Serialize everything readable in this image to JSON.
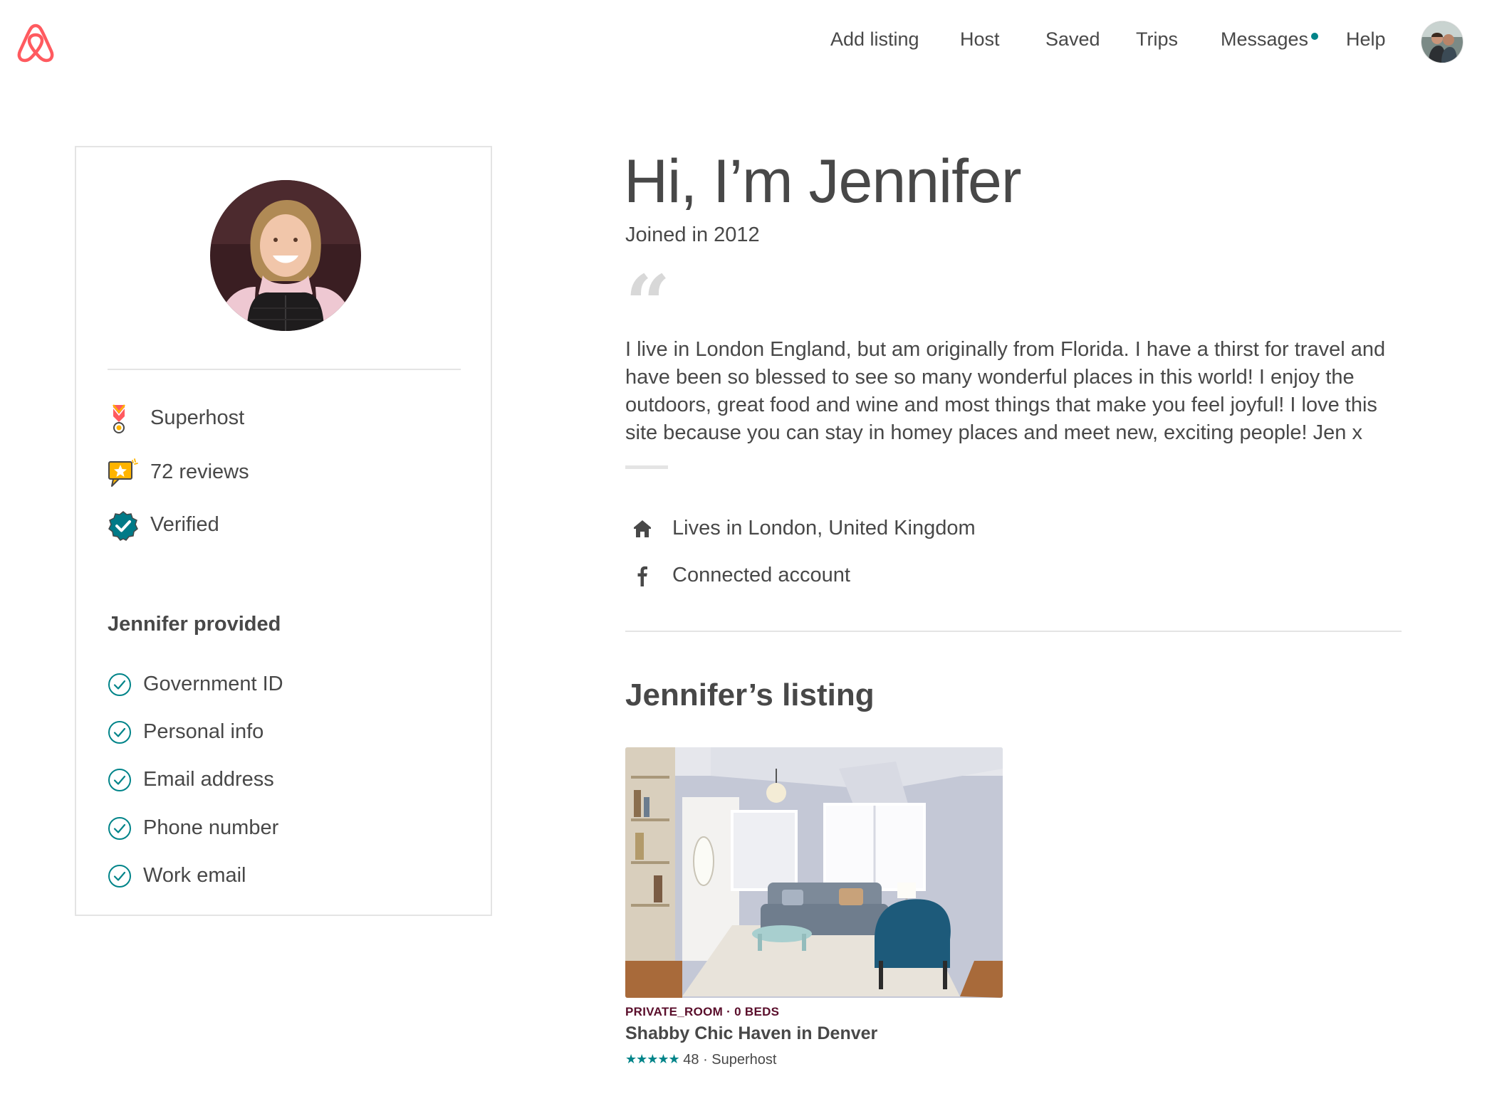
{
  "header": {
    "logo_icon": "airbnb-logo-icon",
    "nav": [
      {
        "label": "Add listing"
      },
      {
        "label": "Host"
      },
      {
        "label": "Saved"
      },
      {
        "label": "Trips"
      },
      {
        "label": "Messages",
        "has_notification": true
      },
      {
        "label": "Help"
      }
    ],
    "avatar_icon": "user-avatar"
  },
  "profile": {
    "badges": [
      {
        "label": "Superhost",
        "icon": "superhost-medal-icon"
      },
      {
        "label": "72 reviews",
        "icon": "reviews-star-bubble-icon"
      },
      {
        "label": "Verified",
        "icon": "verified-shield-icon"
      }
    ],
    "provided_title": "Jennifer provided",
    "provided_items": [
      {
        "label": "Government ID"
      },
      {
        "label": "Personal info"
      },
      {
        "label": "Email address"
      },
      {
        "label": "Phone number"
      },
      {
        "label": "Work email"
      }
    ]
  },
  "main": {
    "greeting": "Hi, I’m Jennifer",
    "joined": "Joined in 2012",
    "quote_mark": "“",
    "about": "I live in London England, but am originally from Florida. I have a thirst for travel and have been so blessed to see so many wonderful places in this world! I enjoy the outdoors, great food and wine and most things that make you feel joyful! I love this site because you can stay in homey places and meet new, exciting people! Jen x",
    "info": [
      {
        "label": "Lives in London, United Kingdom",
        "icon": "home-icon"
      },
      {
        "label": "Connected account",
        "icon": "facebook-icon"
      }
    ],
    "listing_heading": "Jennifer’s listing",
    "listing": {
      "type": "PRIVATE_ROOM · 0 BEDS",
      "title": "Shabby Chic Haven in Denver",
      "stars": "★★★★★",
      "rating_count": "48",
      "rating_suffix": "· Superhost"
    }
  },
  "colors": {
    "brand": "#FF5A5F",
    "teal": "#008489",
    "text": "#484848",
    "listing_type": "#5A0E2B",
    "divider": "#E4E4E4"
  }
}
